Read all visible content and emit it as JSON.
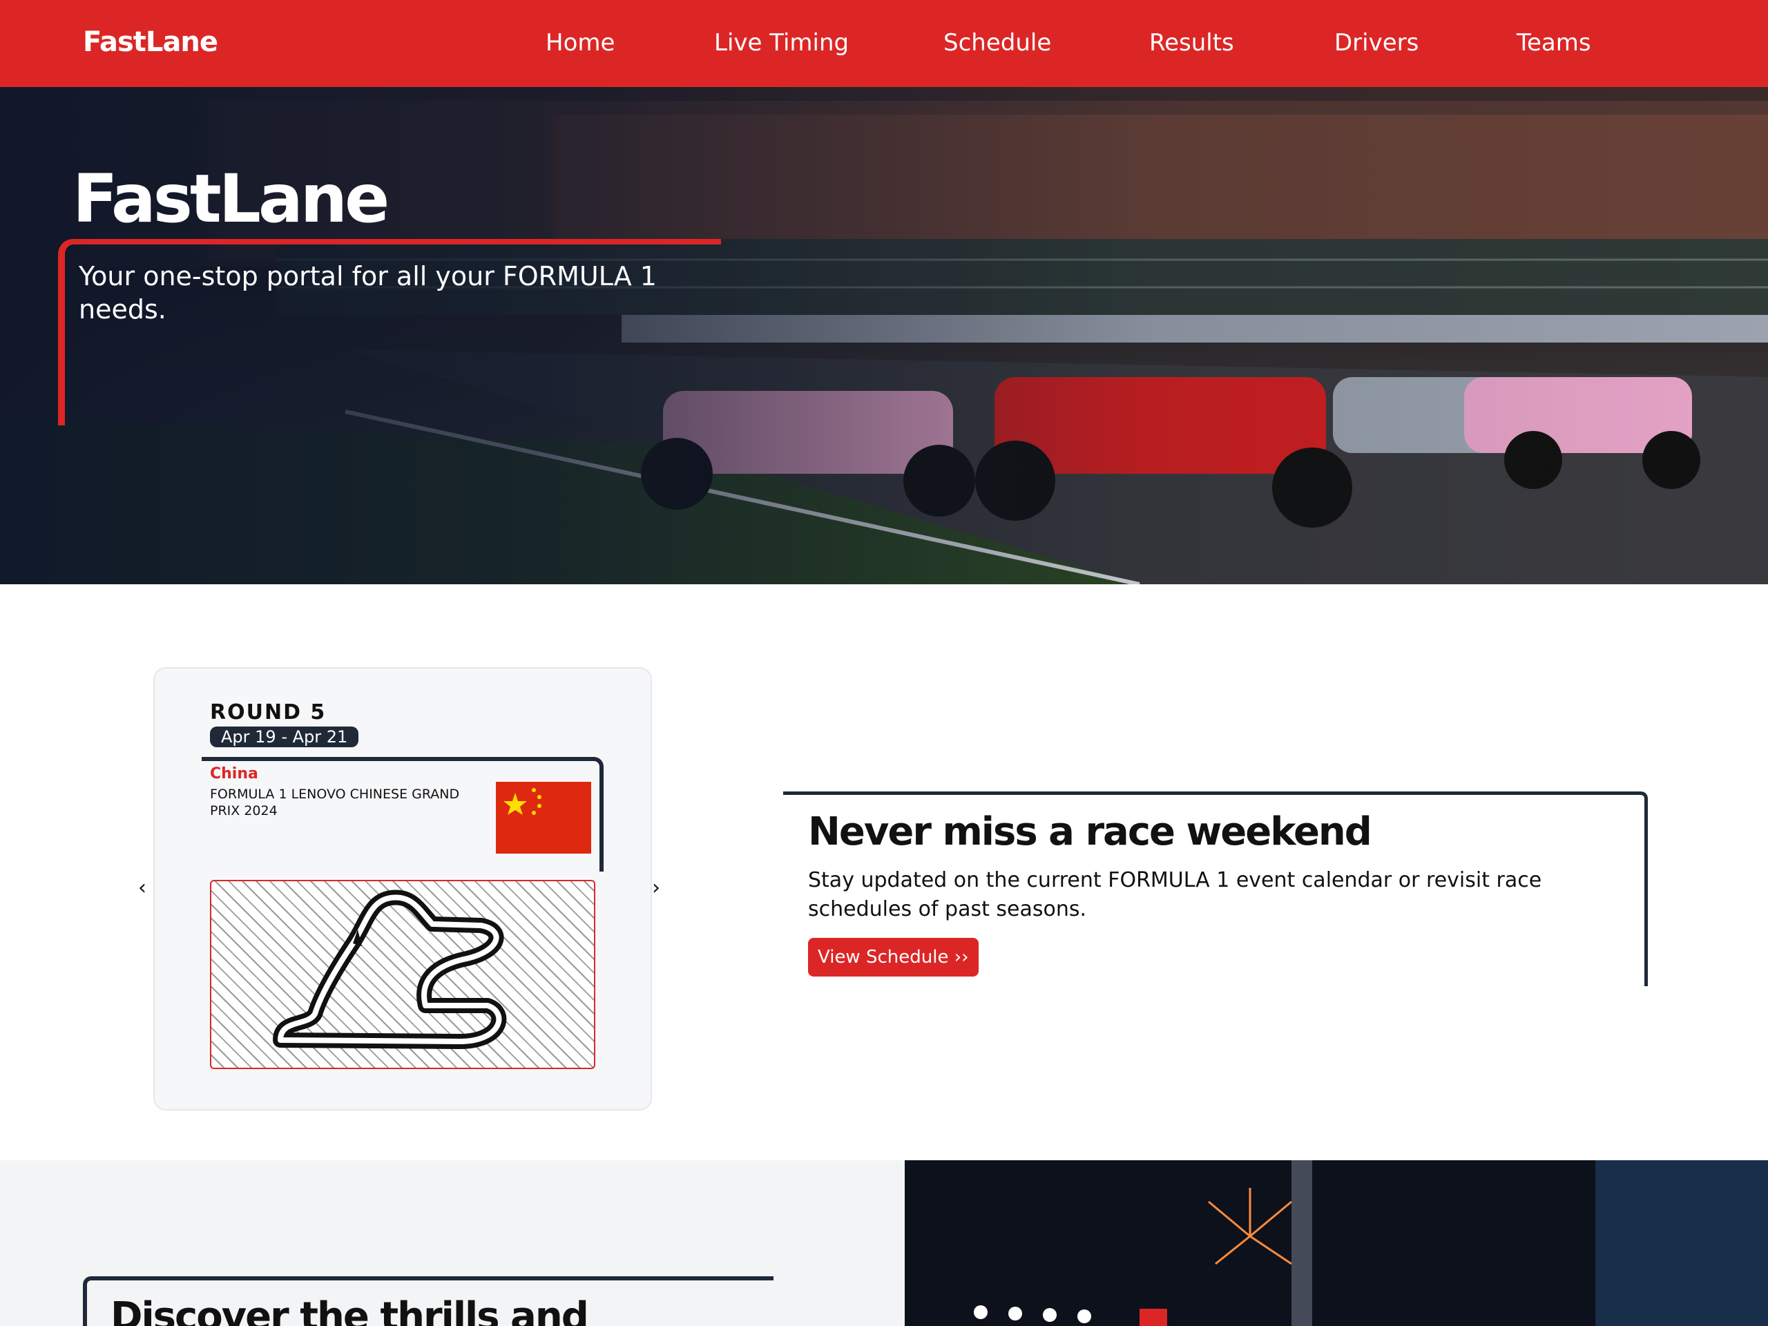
{
  "navbar": {
    "brand": "FastLane",
    "links": [
      "Home",
      "Live Timing",
      "Schedule",
      "Results",
      "Drivers",
      "Teams"
    ]
  },
  "hero": {
    "title": "FastLane",
    "tagline": "Your one-stop portal for all your FORMULA 1 needs."
  },
  "schedule": {
    "card": {
      "round": "ROUND 5",
      "dates": "Apr 19 - Apr 21",
      "country": "China",
      "race_name": "FORMULA 1 LENOVO CHINESE GRAND PRIX 2024"
    },
    "prev_arrow": "‹",
    "next_arrow": "›",
    "heading": "Never miss a race weekend",
    "text": "Stay updated on the current FORMULA 1 event calendar or revisit race schedules of past seasons.",
    "button": "View Schedule ››"
  },
  "discover": {
    "heading": "Discover the thrills and"
  },
  "colors": {
    "accent": "#dc2626",
    "dark": "#1f2937",
    "section_bg": "#f3f4f6"
  }
}
